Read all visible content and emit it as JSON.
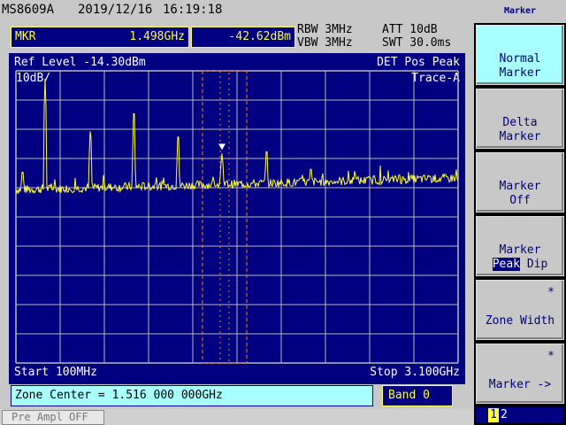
{
  "header": {
    "model": "MS8609A",
    "date": "2019/12/16",
    "time": "16:19:18"
  },
  "marker_readout": {
    "label": "MKR",
    "frequency": "1.498GHz",
    "level": "-42.62dBm"
  },
  "settings": {
    "rbw": "RBW 3MHz",
    "vbw": "VBW 3MHz",
    "att": "ATT 10dB",
    "swt": "SWT 30.0ms"
  },
  "graph": {
    "ref_level": "Ref Level -14.30dBm",
    "scale": "10dB/",
    "detector": "DET  Pos Peak",
    "trace": "Trace-A",
    "start": "Start 100MHz",
    "stop": "Stop 3.100GHz"
  },
  "chart_data": {
    "type": "line",
    "x_unit": "GHz",
    "y_unit": "dBm",
    "xlim": [
      0.1,
      3.1
    ],
    "ylim": [
      -114.3,
      -14.3
    ],
    "grid": true,
    "noise_floor_dbm": -55,
    "peaks": [
      {
        "x": 0.145,
        "y": -49
      },
      {
        "x": 0.298,
        "y": -17
      },
      {
        "x": 0.605,
        "y": -35
      },
      {
        "x": 0.9,
        "y": -29
      },
      {
        "x": 1.2,
        "y": -37
      },
      {
        "x": 1.498,
        "y": -42.6
      },
      {
        "x": 1.8,
        "y": -42
      },
      {
        "x": 2.1,
        "y": -48
      },
      {
        "x": 2.4,
        "y": -50
      },
      {
        "x": 2.7,
        "y": -50
      }
    ],
    "zone_center_ghz": 1.516,
    "zone_width_ghz": 0.3
  },
  "zone": {
    "center_text": "Zone Center = 1.516 000 000GHz",
    "band": "Band 0"
  },
  "status": {
    "preampl": "Pre Ampl OFF"
  },
  "softkeys": {
    "title": "Marker",
    "keys": [
      {
        "line1": "Normal",
        "line2": "Marker"
      },
      {
        "line1": "Delta",
        "line2": "Marker"
      },
      {
        "line1": "Marker",
        "line2": "Off"
      },
      {
        "line1": "Marker",
        "hl": "Peak",
        "rest": " Dip"
      },
      {
        "star": "*",
        "line1": "Zone Width"
      },
      {
        "star": "*",
        "line1": "Marker ->"
      }
    ],
    "page_current": "1",
    "page_other": "2"
  },
  "colors": {
    "trace": "#ffff33",
    "graph_bg": "#000080",
    "zone": "#ff8000",
    "active_key": "#a8ffff"
  }
}
